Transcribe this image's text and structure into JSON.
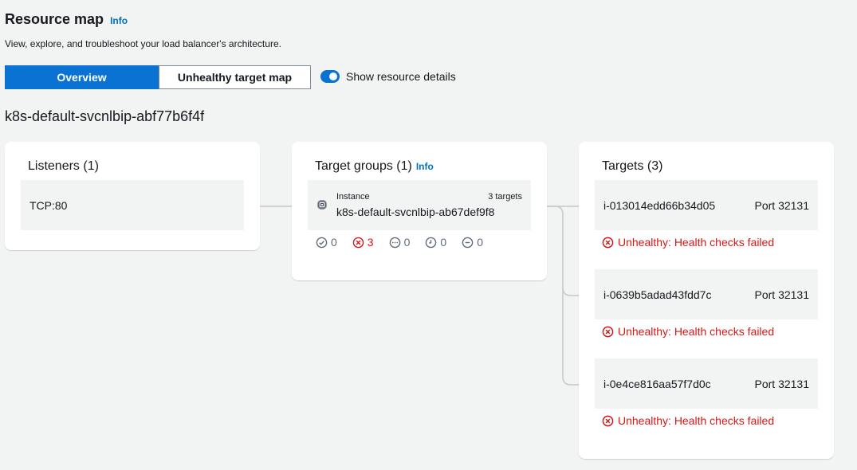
{
  "header": {
    "title": "Resource map",
    "info_label": "Info",
    "subtitle": "View, explore, and troubleshoot your load balancer's architecture."
  },
  "tabs": [
    {
      "label": "Overview",
      "active": true
    },
    {
      "label": "Unhealthy target map",
      "active": false
    }
  ],
  "toggle": {
    "label": "Show resource details",
    "on": true
  },
  "load_balancer_name": "k8s-default-svcnlbip-abf77b6f4f",
  "listeners": {
    "title": "Listeners (1)",
    "items": [
      {
        "label": "TCP:80"
      }
    ]
  },
  "target_groups": {
    "title": "Target groups (1)",
    "info_label": "Info",
    "items": [
      {
        "type": "Instance",
        "targets_count": "3 targets",
        "name": "k8s-default-svcnlbip-ab67def9f8",
        "icon": "chip-icon"
      }
    ],
    "counts": {
      "healthy": "0",
      "unhealthy": "3",
      "unused": "0",
      "initial": "0",
      "draining": "0"
    }
  },
  "targets": {
    "title": "Targets (3)",
    "items": [
      {
        "id": "i-013014edd66b34d05",
        "port": "Port 32131",
        "status": "Unhealthy: Health checks failed"
      },
      {
        "id": "i-0639b5adad43fdd7c",
        "port": "Port 32131",
        "status": "Unhealthy: Health checks failed"
      },
      {
        "id": "i-0e4ce816aa57f7d0c",
        "port": "Port 32131",
        "status": "Unhealthy: Health checks failed"
      }
    ]
  },
  "colors": {
    "accent": "#0972d3",
    "error": "#d91515",
    "link": "#0073bb",
    "background": "#f2f3f3"
  }
}
